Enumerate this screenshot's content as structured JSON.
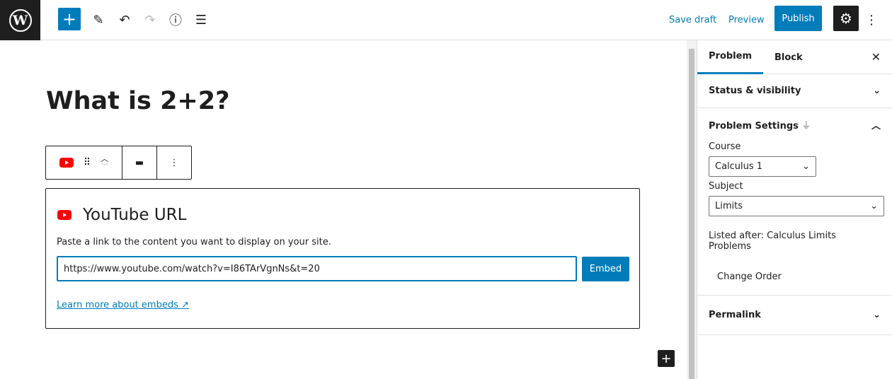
{
  "topbar": {
    "logo": "W",
    "add": "+",
    "save_draft": "Save draft",
    "preview": "Preview",
    "publish": "Publish"
  },
  "post": {
    "title": "What is 2+2?"
  },
  "embed": {
    "title": "YouTube URL",
    "description": "Paste a link to the content you want to display on your site.",
    "url": "https://www.youtube.com/watch?v=I86TArVgnNs&t=20",
    "button": "Embed",
    "learn_more": "Learn more about embeds"
  },
  "sidebar": {
    "tabs": [
      {
        "label": "Problem",
        "active": true
      },
      {
        "label": "Block",
        "active": false
      }
    ],
    "status_visibility": "Status & visibility",
    "problem_settings": {
      "title": "Problem Settings",
      "course_label": "Course",
      "course_value": "Calculus 1",
      "subject_label": "Subject",
      "subject_value": "Limits",
      "listed_after": "Listed after: Calculus Limits Problems",
      "change_order": "Change Order"
    },
    "permalink": "Permalink"
  },
  "colors": {
    "accent": "#007cba",
    "youtube": "#ff0000",
    "dark": "#1e1e1e"
  }
}
